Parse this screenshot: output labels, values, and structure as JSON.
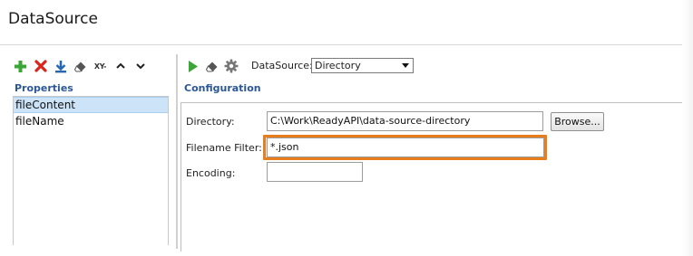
{
  "window": {
    "title": "DataSource"
  },
  "left_toolbar": {
    "icons": [
      "add-icon",
      "delete-icon",
      "download-icon",
      "eraser-icon",
      "xy-icon",
      "move-up-icon",
      "move-down-icon"
    ],
    "xy_label": "XY-"
  },
  "properties": {
    "heading": "Properties",
    "items": [
      {
        "label": "fileContent",
        "selected": true
      },
      {
        "label": "fileName",
        "selected": false
      }
    ]
  },
  "right_toolbar": {
    "icons": [
      "run-icon",
      "eraser-icon",
      "gear-icon"
    ],
    "datasource_label": "DataSource:",
    "datasource_value": "Directory"
  },
  "configuration": {
    "heading": "Configuration",
    "directory_label": "Directory:",
    "directory_value": "C:\\Work\\ReadyAPI\\data-source-directory",
    "browse_label": "Browse...",
    "filter_label": "Filename Filter:",
    "filter_value": "*.json",
    "encoding_label": "Encoding:",
    "encoding_value": ""
  },
  "colors": {
    "accent": "#2b5797",
    "highlight": "#e87d1e",
    "selection": "#cde3f7",
    "add_green": "#3aa635",
    "delete_red": "#d9261c",
    "download_blue": "#2667b5"
  }
}
